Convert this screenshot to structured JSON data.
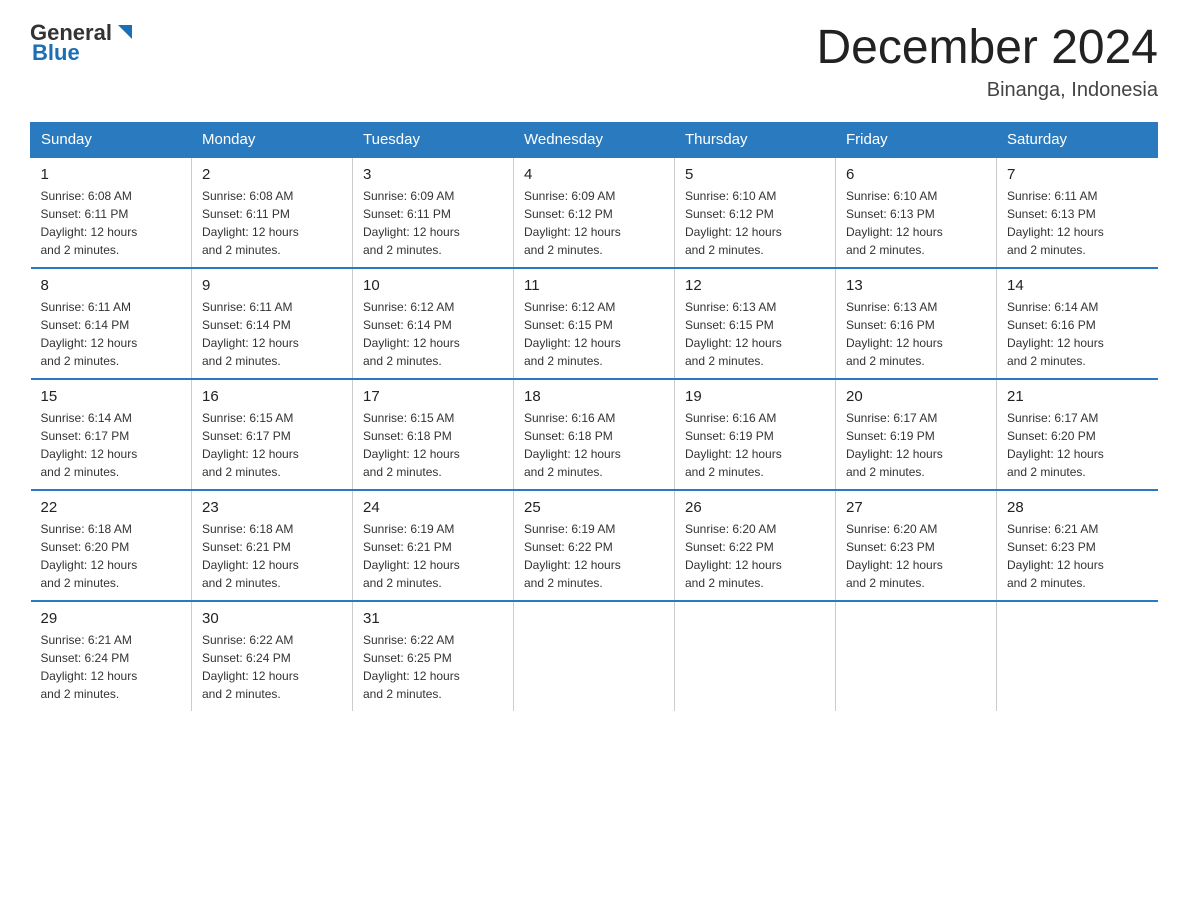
{
  "header": {
    "logo_general": "General",
    "logo_blue": "Blue",
    "title": "December 2024",
    "subtitle": "Binanga, Indonesia"
  },
  "columns": [
    "Sunday",
    "Monday",
    "Tuesday",
    "Wednesday",
    "Thursday",
    "Friday",
    "Saturday"
  ],
  "weeks": [
    [
      {
        "day": "1",
        "sunrise": "6:08 AM",
        "sunset": "6:11 PM",
        "daylight": "12 hours and 2 minutes."
      },
      {
        "day": "2",
        "sunrise": "6:08 AM",
        "sunset": "6:11 PM",
        "daylight": "12 hours and 2 minutes."
      },
      {
        "day": "3",
        "sunrise": "6:09 AM",
        "sunset": "6:11 PM",
        "daylight": "12 hours and 2 minutes."
      },
      {
        "day": "4",
        "sunrise": "6:09 AM",
        "sunset": "6:12 PM",
        "daylight": "12 hours and 2 minutes."
      },
      {
        "day": "5",
        "sunrise": "6:10 AM",
        "sunset": "6:12 PM",
        "daylight": "12 hours and 2 minutes."
      },
      {
        "day": "6",
        "sunrise": "6:10 AM",
        "sunset": "6:13 PM",
        "daylight": "12 hours and 2 minutes."
      },
      {
        "day": "7",
        "sunrise": "6:11 AM",
        "sunset": "6:13 PM",
        "daylight": "12 hours and 2 minutes."
      }
    ],
    [
      {
        "day": "8",
        "sunrise": "6:11 AM",
        "sunset": "6:14 PM",
        "daylight": "12 hours and 2 minutes."
      },
      {
        "day": "9",
        "sunrise": "6:11 AM",
        "sunset": "6:14 PM",
        "daylight": "12 hours and 2 minutes."
      },
      {
        "day": "10",
        "sunrise": "6:12 AM",
        "sunset": "6:14 PM",
        "daylight": "12 hours and 2 minutes."
      },
      {
        "day": "11",
        "sunrise": "6:12 AM",
        "sunset": "6:15 PM",
        "daylight": "12 hours and 2 minutes."
      },
      {
        "day": "12",
        "sunrise": "6:13 AM",
        "sunset": "6:15 PM",
        "daylight": "12 hours and 2 minutes."
      },
      {
        "day": "13",
        "sunrise": "6:13 AM",
        "sunset": "6:16 PM",
        "daylight": "12 hours and 2 minutes."
      },
      {
        "day": "14",
        "sunrise": "6:14 AM",
        "sunset": "6:16 PM",
        "daylight": "12 hours and 2 minutes."
      }
    ],
    [
      {
        "day": "15",
        "sunrise": "6:14 AM",
        "sunset": "6:17 PM",
        "daylight": "12 hours and 2 minutes."
      },
      {
        "day": "16",
        "sunrise": "6:15 AM",
        "sunset": "6:17 PM",
        "daylight": "12 hours and 2 minutes."
      },
      {
        "day": "17",
        "sunrise": "6:15 AM",
        "sunset": "6:18 PM",
        "daylight": "12 hours and 2 minutes."
      },
      {
        "day": "18",
        "sunrise": "6:16 AM",
        "sunset": "6:18 PM",
        "daylight": "12 hours and 2 minutes."
      },
      {
        "day": "19",
        "sunrise": "6:16 AM",
        "sunset": "6:19 PM",
        "daylight": "12 hours and 2 minutes."
      },
      {
        "day": "20",
        "sunrise": "6:17 AM",
        "sunset": "6:19 PM",
        "daylight": "12 hours and 2 minutes."
      },
      {
        "day": "21",
        "sunrise": "6:17 AM",
        "sunset": "6:20 PM",
        "daylight": "12 hours and 2 minutes."
      }
    ],
    [
      {
        "day": "22",
        "sunrise": "6:18 AM",
        "sunset": "6:20 PM",
        "daylight": "12 hours and 2 minutes."
      },
      {
        "day": "23",
        "sunrise": "6:18 AM",
        "sunset": "6:21 PM",
        "daylight": "12 hours and 2 minutes."
      },
      {
        "day": "24",
        "sunrise": "6:19 AM",
        "sunset": "6:21 PM",
        "daylight": "12 hours and 2 minutes."
      },
      {
        "day": "25",
        "sunrise": "6:19 AM",
        "sunset": "6:22 PM",
        "daylight": "12 hours and 2 minutes."
      },
      {
        "day": "26",
        "sunrise": "6:20 AM",
        "sunset": "6:22 PM",
        "daylight": "12 hours and 2 minutes."
      },
      {
        "day": "27",
        "sunrise": "6:20 AM",
        "sunset": "6:23 PM",
        "daylight": "12 hours and 2 minutes."
      },
      {
        "day": "28",
        "sunrise": "6:21 AM",
        "sunset": "6:23 PM",
        "daylight": "12 hours and 2 minutes."
      }
    ],
    [
      {
        "day": "29",
        "sunrise": "6:21 AM",
        "sunset": "6:24 PM",
        "daylight": "12 hours and 2 minutes."
      },
      {
        "day": "30",
        "sunrise": "6:22 AM",
        "sunset": "6:24 PM",
        "daylight": "12 hours and 2 minutes."
      },
      {
        "day": "31",
        "sunrise": "6:22 AM",
        "sunset": "6:25 PM",
        "daylight": "12 hours and 2 minutes."
      },
      null,
      null,
      null,
      null
    ]
  ]
}
